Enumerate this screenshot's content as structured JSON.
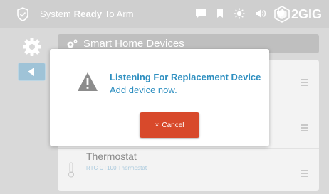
{
  "status_bar": {
    "prefix": "System ",
    "state": "Ready",
    "suffix": " To Arm",
    "brand": "2GIG",
    "icons": [
      "message-icon",
      "bookmark-icon",
      "brightness-icon",
      "volume-icon",
      "plug-icon"
    ]
  },
  "section": {
    "title": "Smart Home Devices"
  },
  "devices": [
    {
      "name": "Thermostat",
      "model": "RTC CT100 Thermostat"
    }
  ],
  "modal": {
    "title": "Listening For Replacement Device",
    "message": "Add device now.",
    "cancel_symbol": "×",
    "cancel_label": "Cancel"
  },
  "colors": {
    "accent_blue": "#2e8fc0",
    "cancel_red": "#d8492b",
    "topbar_grey": "#cfcfcf"
  }
}
